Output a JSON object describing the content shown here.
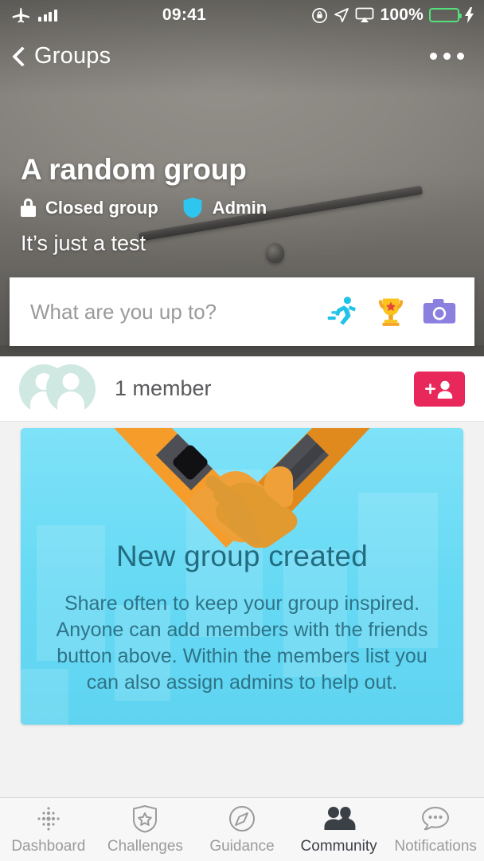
{
  "status_bar": {
    "airplane_icon": "airplane-mode-icon",
    "signal_icon": "signal-bars-icon",
    "time": "09:41",
    "rotation_lock_icon": "rotation-lock-icon",
    "location_icon": "location-arrow-icon",
    "airplay_icon": "airplay-icon",
    "battery_percent": "100%",
    "battery_icon": "battery-full-icon",
    "charging_icon": "lightning-bolt-icon",
    "battery_color": "#52e07a"
  },
  "navbar": {
    "back_icon": "chevron-left-icon",
    "back_label": "Groups",
    "more_icon": "overflow-menu-icon"
  },
  "group": {
    "title": "A random group",
    "privacy_icon": "lock-icon",
    "privacy_label": "Closed group",
    "role_icon": "shield-icon",
    "role_label": "Admin",
    "role_color": "#2ec6ef",
    "description": "It’s just a test"
  },
  "composer": {
    "placeholder": "What are you up to?",
    "value": "",
    "actions": [
      {
        "icon": "runner-icon",
        "color": "#22c2e8"
      },
      {
        "icon": "trophy-icon",
        "color": "#f6c321"
      },
      {
        "icon": "camera-icon",
        "color": "#8b7fe0"
      }
    ]
  },
  "members": {
    "avatars_icon": "group-avatars-placeholder",
    "count_label": "1 member",
    "add_button_icon": "add-person-icon",
    "add_button_color": "#e8275a"
  },
  "feed_card": {
    "illustration_icon": "handshake-illustration",
    "title": "New group created",
    "body": "Share often to keep your group inspired. Anyone can add members with the friends button above. Within the members list you can also assign admins to help out.",
    "background_color": "#6edcf6",
    "title_color": "#226c80"
  },
  "tabbar": {
    "items": [
      {
        "label": "Dashboard",
        "icon": "fitbit-dots-icon",
        "active": false
      },
      {
        "label": "Challenges",
        "icon": "shield-star-icon",
        "active": false
      },
      {
        "label": "Guidance",
        "icon": "compass-icon",
        "active": false
      },
      {
        "label": "Community",
        "icon": "two-people-icon",
        "active": true
      },
      {
        "label": "Notifications",
        "icon": "speech-bubble-icon",
        "active": false
      }
    ]
  }
}
